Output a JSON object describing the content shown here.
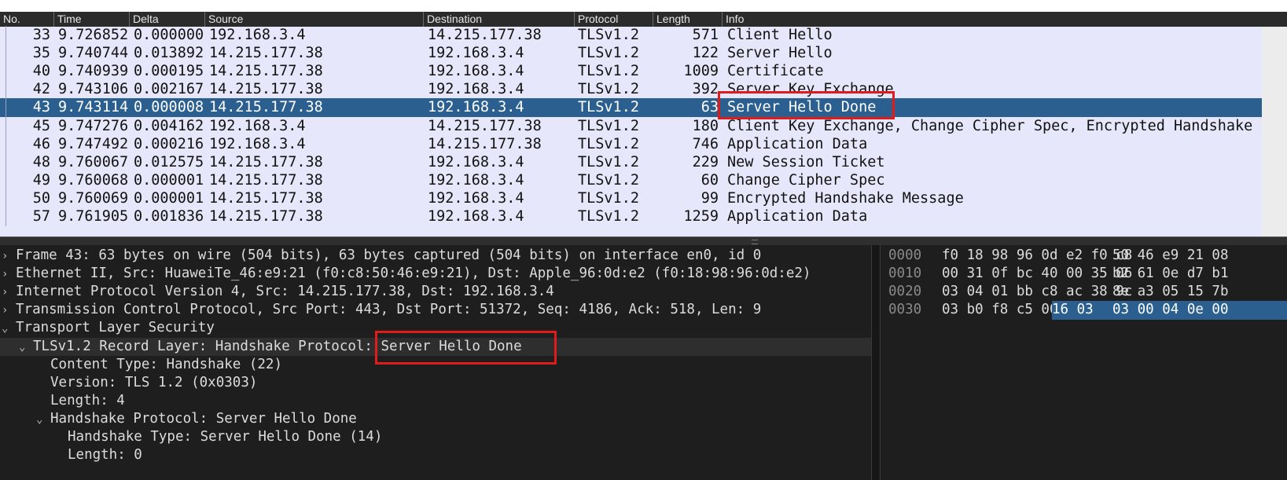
{
  "packet_list": {
    "columns": [
      "No.",
      "Time",
      "Delta",
      "Source",
      "Destination",
      "Protocol",
      "Length",
      "Info"
    ],
    "rows": [
      {
        "no": "33",
        "time": "9.726852",
        "delta": "0.000000",
        "src": "192.168.3.4",
        "dst": "14.215.177.38",
        "proto": "TLSv1.2",
        "len": "571",
        "info": "Client Hello"
      },
      {
        "no": "35",
        "time": "9.740744",
        "delta": "0.013892",
        "src": "14.215.177.38",
        "dst": "192.168.3.4",
        "proto": "TLSv1.2",
        "len": "122",
        "info": "Server Hello"
      },
      {
        "no": "40",
        "time": "9.740939",
        "delta": "0.000195",
        "src": "14.215.177.38",
        "dst": "192.168.3.4",
        "proto": "TLSv1.2",
        "len": "1009",
        "info": "Certificate"
      },
      {
        "no": "42",
        "time": "9.743106",
        "delta": "0.002167",
        "src": "14.215.177.38",
        "dst": "192.168.3.4",
        "proto": "TLSv1.2",
        "len": "392",
        "info": "Server Key Exchange"
      },
      {
        "no": "43",
        "time": "9.743114",
        "delta": "0.000008",
        "src": "14.215.177.38",
        "dst": "192.168.3.4",
        "proto": "TLSv1.2",
        "len": "63",
        "info": "Server Hello Done"
      },
      {
        "no": "45",
        "time": "9.747276",
        "delta": "0.004162",
        "src": "192.168.3.4",
        "dst": "14.215.177.38",
        "proto": "TLSv1.2",
        "len": "180",
        "info": "Client Key Exchange, Change Cipher Spec, Encrypted Handshake"
      },
      {
        "no": "46",
        "time": "9.747492",
        "delta": "0.000216",
        "src": "192.168.3.4",
        "dst": "14.215.177.38",
        "proto": "TLSv1.2",
        "len": "746",
        "info": "Application Data"
      },
      {
        "no": "48",
        "time": "9.760067",
        "delta": "0.012575",
        "src": "14.215.177.38",
        "dst": "192.168.3.4",
        "proto": "TLSv1.2",
        "len": "229",
        "info": "New Session Ticket"
      },
      {
        "no": "49",
        "time": "9.760068",
        "delta": "0.000001",
        "src": "14.215.177.38",
        "dst": "192.168.3.4",
        "proto": "TLSv1.2",
        "len": "60",
        "info": "Change Cipher Spec"
      },
      {
        "no": "50",
        "time": "9.760069",
        "delta": "0.000001",
        "src": "14.215.177.38",
        "dst": "192.168.3.4",
        "proto": "TLSv1.2",
        "len": "99",
        "info": "Encrypted Handshake Message"
      },
      {
        "no": "57",
        "time": "9.761905",
        "delta": "0.001836",
        "src": "14.215.177.38",
        "dst": "192.168.3.4",
        "proto": "TLSv1.2",
        "len": "1259",
        "info": "Application Data"
      }
    ],
    "selected_no": "43"
  },
  "details": {
    "lines": [
      {
        "expander": "collapsed",
        "text": "Frame 43: 63 bytes on wire (504 bits), 63 bytes captured (504 bits) on interface en0, id 0"
      },
      {
        "expander": "collapsed",
        "text": "Ethernet II, Src: HuaweiTe_46:e9:21 (f0:c8:50:46:e9:21), Dst: Apple_96:0d:e2 (f0:18:98:96:0d:e2)"
      },
      {
        "expander": "collapsed",
        "text": "Internet Protocol Version 4, Src: 14.215.177.38, Dst: 192.168.3.4"
      },
      {
        "expander": "collapsed",
        "text": "Transmission Control Protocol, Src Port: 443, Dst Port: 51372, Seq: 4186, Ack: 518, Len: 9"
      },
      {
        "expander": "expanded",
        "text": "Transport Layer Security"
      },
      {
        "expander": "expanded",
        "text": "TLSv1.2 Record Layer: Handshake Protocol: Server Hello Done"
      },
      {
        "expander": "none",
        "text": "Content Type: Handshake (22)"
      },
      {
        "expander": "none",
        "text": "Version: TLS 1.2 (0x0303)"
      },
      {
        "expander": "none",
        "text": "Length: 4"
      },
      {
        "expander": "expanded",
        "text": "Handshake Protocol: Server Hello Done"
      },
      {
        "expander": "none",
        "text": "Handshake Type: Server Hello Done (14)"
      },
      {
        "expander": "none",
        "text": "Length: 0"
      }
    ]
  },
  "bytes": {
    "lines": [
      {
        "offset": "0000",
        "a": "f0 18 98 96 0d e2 f0 c8",
        "b": "50 46 e9 21 08"
      },
      {
        "offset": "0010",
        "a": "00 31 0f bc 40 00 35 06",
        "b": "b2 61 0e d7 b1"
      },
      {
        "offset": "0020",
        "a": "03 04 01 bb c8 ac 38 9c",
        "b": "8e a3 05 15 7b"
      },
      {
        "offset": "0030",
        "a": "03 b0 f8 c5 00 00",
        "a_sel": "16 03",
        "b": "03 00 04 0e 00"
      }
    ]
  },
  "colors": {
    "row_bg": "#e7e7fb",
    "selected_bg": "#2b5f8f",
    "annotation": "#e01b1b"
  },
  "icons": {
    "expander_collapsed": "chevron-right-icon",
    "expander_expanded": "chevron-down-icon"
  }
}
